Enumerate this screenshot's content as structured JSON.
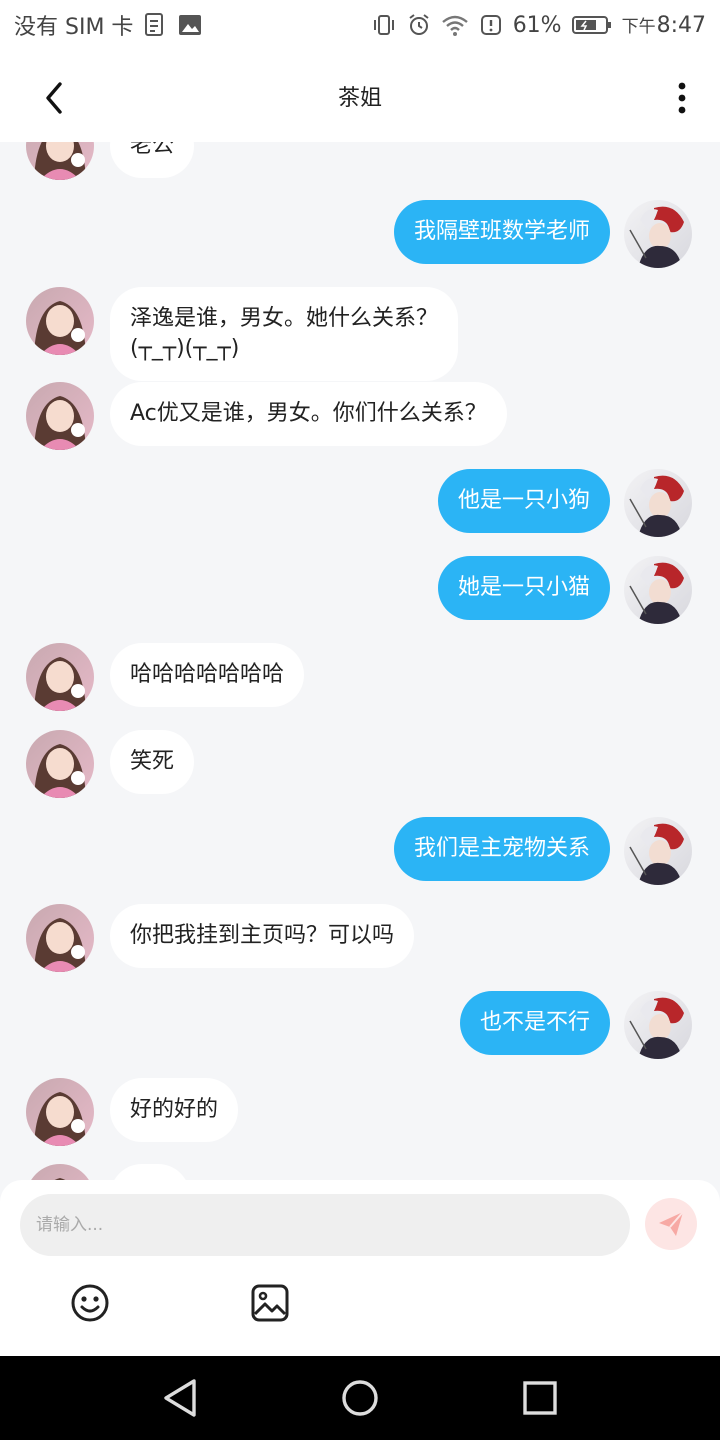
{
  "status_bar": {
    "carrier": "没有 SIM 卡",
    "battery": "61%",
    "time_prefix": "下午",
    "time": "8:47",
    "icons": [
      "file-icon",
      "image-icon",
      "vibrate-icon",
      "alarm-icon",
      "wifi-icon",
      "alert-icon",
      "battery-icon"
    ]
  },
  "header": {
    "title": "茶姐"
  },
  "messages": [
    {
      "side": "in",
      "text": "老公"
    },
    {
      "side": "out",
      "text": "我隔壁班数学老师"
    },
    {
      "side": "in",
      "text": "泽逸是谁，男女。她什么关系？\n(┬_┬)(┬_┬)"
    },
    {
      "side": "in",
      "text": "Ac优又是谁，男女。你们什么关系？"
    },
    {
      "side": "out",
      "text": "他是一只小狗"
    },
    {
      "side": "out",
      "text": "她是一只小猫"
    },
    {
      "side": "in",
      "text": "哈哈哈哈哈哈哈"
    },
    {
      "side": "in",
      "text": "笑死"
    },
    {
      "side": "out",
      "text": "我们是主宠物关系"
    },
    {
      "side": "in",
      "text": "你把我挂到主页吗？可以吗"
    },
    {
      "side": "out",
      "text": "也不是不行"
    },
    {
      "side": "in",
      "text": "好的好的"
    },
    {
      "side": "in",
      "text": ""
    }
  ],
  "input": {
    "placeholder": "请输入..."
  },
  "colors": {
    "outgoing_bubble": "#2bb4f5",
    "incoming_bubble": "#ffffff",
    "send_button_bg": "#fde5e4",
    "send_icon": "#f7a9a4"
  }
}
